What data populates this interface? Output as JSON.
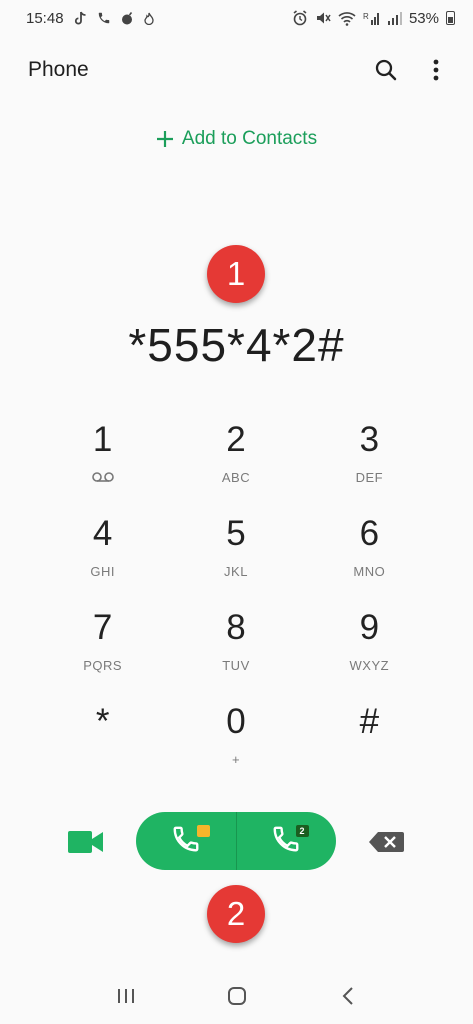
{
  "status_bar": {
    "time": "15:48",
    "battery_percent": "53%",
    "left_icons": [
      "tiktok-icon",
      "phone-call-icon",
      "bomb-icon",
      "flame-icon"
    ],
    "right_icons": [
      "alarm-icon",
      "mute-icon",
      "wifi-icon",
      "signal-r-icon",
      "signal-icon",
      "battery-icon"
    ]
  },
  "app_bar": {
    "title": "Phone",
    "actions": [
      "search-icon",
      "more-vert-icon"
    ]
  },
  "add_contacts": {
    "label": "Add to Contacts"
  },
  "dialed_number": "*555*4*2#",
  "callouts": {
    "first": "1",
    "second": "2"
  },
  "keypad": [
    {
      "digit": "1",
      "sub": "",
      "sub_icon": "voicemail-icon"
    },
    {
      "digit": "2",
      "sub": "ABC"
    },
    {
      "digit": "3",
      "sub": "DEF"
    },
    {
      "digit": "4",
      "sub": "GHI"
    },
    {
      "digit": "5",
      "sub": "JKL"
    },
    {
      "digit": "6",
      "sub": "MNO"
    },
    {
      "digit": "7",
      "sub": "PQRS"
    },
    {
      "digit": "8",
      "sub": "TUV"
    },
    {
      "digit": "9",
      "sub": "WXYZ"
    },
    {
      "digit": "*",
      "sub": ""
    },
    {
      "digit": "0",
      "sub": "+"
    },
    {
      "digit": "#",
      "sub": ""
    }
  ],
  "actions": {
    "sim1_badge": "",
    "sim2_badge": "2",
    "icons": [
      "video-call-icon",
      "call-sim1-icon",
      "call-sim2-icon",
      "backspace-icon"
    ]
  },
  "nav_bar": {
    "icons": [
      "recents-icon",
      "home-icon",
      "back-icon"
    ]
  },
  "colors": {
    "accent": "#1fb463",
    "link": "#1b9e5a",
    "callout": "#e53935"
  }
}
